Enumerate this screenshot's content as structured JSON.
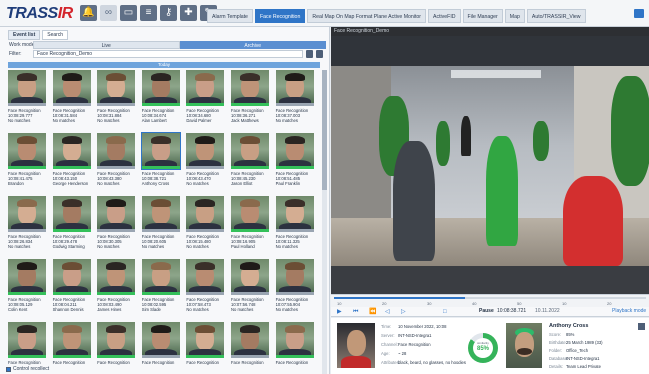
{
  "app": {
    "logo_main": "TRASS",
    "logo_accent": "IR",
    "toolbar_icons": [
      "alarm-bell-icon",
      "camera-link-icon",
      "monitor-icon",
      "layout-icon",
      "key-icon",
      "puzzle-icon",
      "edit-icon"
    ],
    "tabs": [
      "Alarm Template",
      "Face Recognition",
      "Real Map On Map Format Plane Active Monitor",
      "ActiveFID",
      "File Manager",
      "Map",
      "Auto/TRASSIR_View"
    ],
    "active_tab": 1
  },
  "left_panel": {
    "tabs": [
      "Event list",
      "Search"
    ],
    "work_mode_label": "Work mode:",
    "modes": [
      "Live",
      "Archive"
    ],
    "active_mode": 1,
    "filter_label": "Filter:",
    "filter_value": "Face Recognition_Demo",
    "group_header": "Today",
    "footer_label": "Control recollect"
  },
  "cards": [
    {
      "t1": "Face Recognition",
      "t2": "10:08:29.777",
      "t3": "No matches",
      "green": false
    },
    {
      "t1": "Face Recognition",
      "t2": "10:08:31.584",
      "t3": "No matches",
      "green": false
    },
    {
      "t1": "Face Recognition",
      "t2": "10:08:31.884",
      "t3": "No matches",
      "green": false
    },
    {
      "t1": "Face Recognition",
      "t2": "10:08:34.674",
      "t3": "Alan Lambert",
      "green": true
    },
    {
      "t1": "Face Recognition",
      "t2": "10:08:34.680",
      "t3": "David Palmer",
      "green": true
    },
    {
      "t1": "Face Recognition",
      "t2": "10:08:36.271",
      "t3": "Jack Matthews",
      "green": true
    },
    {
      "t1": "Face Recognition",
      "t2": "10:08:37.003",
      "t3": "No matches",
      "green": false
    },
    {
      "t1": "Face Recognition",
      "t2": "10:08:41.475",
      "t3": "Brandon",
      "green": true
    },
    {
      "t1": "Face Recognition",
      "t2": "10:08:43.150",
      "t3": "George Henderson",
      "green": true
    },
    {
      "t1": "Face Recognition",
      "t2": "10:08:43.380",
      "t3": "No matches",
      "green": false
    },
    {
      "t1": "Face Recognition",
      "t2": "10:08:38.721",
      "t3": "Anthony Cross",
      "green": true,
      "selected": true
    },
    {
      "t1": "Face Recognition",
      "t2": "10:08:43.470",
      "t3": "No matches",
      "green": false
    },
    {
      "t1": "Face Recognition",
      "t2": "10:08:45.230",
      "t3": "Jason Elliot",
      "green": true
    },
    {
      "t1": "Face Recognition",
      "t2": "10:08:51.485",
      "t3": "Paul Franklin",
      "green": true
    },
    {
      "t1": "Face Recognition",
      "t2": "10:08:26.834",
      "t3": "No matches",
      "green": false
    },
    {
      "t1": "Face Recognition",
      "t2": "10:08:29.478",
      "t3": "Godwig Starming",
      "green": true
    },
    {
      "t1": "Face Recognition",
      "t2": "10:08:30.305",
      "t3": "No matches",
      "green": false
    },
    {
      "t1": "Face Recognition",
      "t2": "10:08:20.605",
      "t3": "No matches",
      "green": false
    },
    {
      "t1": "Face Recognition",
      "t2": "10:08:15.480",
      "t3": "No matches",
      "green": false
    },
    {
      "t1": "Face Recognition",
      "t2": "10:08:16.905",
      "t3": "Paul Holland",
      "green": true
    },
    {
      "t1": "Face Recognition",
      "t2": "10:08:11.325",
      "t3": "No matches",
      "green": false
    },
    {
      "t1": "Face Recognition",
      "t2": "10:08:05.129",
      "t3": "Colin Kent",
      "green": true
    },
    {
      "t1": "Face Recognition",
      "t2": "10:08:04.211",
      "t3": "Shannon Dennis",
      "green": true
    },
    {
      "t1": "Face Recognition",
      "t2": "10:08:03.490",
      "t3": "James Hines",
      "green": true
    },
    {
      "t1": "Face Recognition",
      "t2": "10:08:02.595",
      "t3": "Sim Slade",
      "green": true
    },
    {
      "t1": "Face Recognition",
      "t2": "10:07:58.473",
      "t3": "No matches",
      "green": false
    },
    {
      "t1": "Face Recognition",
      "t2": "10:07:56.748",
      "t3": "No matches",
      "green": false
    },
    {
      "t1": "Face Recognition",
      "t2": "10:07:55.904",
      "t3": "No matches",
      "green": false
    },
    {
      "t1": "Face Recognition",
      "t2": "",
      "t3": "",
      "green": true
    },
    {
      "t1": "Face Recognition",
      "t2": "",
      "t3": "",
      "green": true
    },
    {
      "t1": "Face Recognition",
      "t2": "",
      "t3": "",
      "green": true
    },
    {
      "t1": "Face Recognition",
      "t2": "",
      "t3": "",
      "green": false
    },
    {
      "t1": "Face Recognition",
      "t2": "",
      "t3": "",
      "green": true
    },
    {
      "t1": "Face Recognition",
      "t2": "",
      "t3": "",
      "green": false
    },
    {
      "t1": "Face Recognition",
      "t2": "",
      "t3": "",
      "green": true
    }
  ],
  "video": {
    "header": "Face Recognition_Demo"
  },
  "timeline": {
    "labels": [
      "10",
      "20",
      "30",
      "40",
      "50",
      "10",
      "20"
    ],
    "progress": 0.42
  },
  "controls": {
    "pause_label": "Pause",
    "time": "10:08:38.721",
    "date": "10.11.2022",
    "playback_mode": "Playback mode"
  },
  "detail": {
    "left": [
      {
        "k": "Time:",
        "v": "10 November 2022, 10:08"
      },
      {
        "k": "Server:",
        "v": "INT-NSD-Integra1"
      },
      {
        "k": "Channel:",
        "v": "Face Recognition"
      },
      {
        "k": "Age:",
        "v": "~ 28"
      },
      {
        "k": "Attributes:",
        "v": "black, beard, no glasses, no hoodies"
      }
    ],
    "similarity_label": "similarity",
    "similarity_value": "85%",
    "similarity": 0.85,
    "person_name": "Anthony Cross",
    "right": [
      {
        "k": "Score:",
        "v": "85%"
      },
      {
        "k": "Birthdate:",
        "v": "25 March 1989 (33)"
      },
      {
        "k": "Folder:",
        "v": "Office_Tech"
      },
      {
        "k": "Database:",
        "v": "INT-NSD-Integra1"
      },
      {
        "k": "Details:",
        "v": "Team Lead Private"
      }
    ]
  }
}
